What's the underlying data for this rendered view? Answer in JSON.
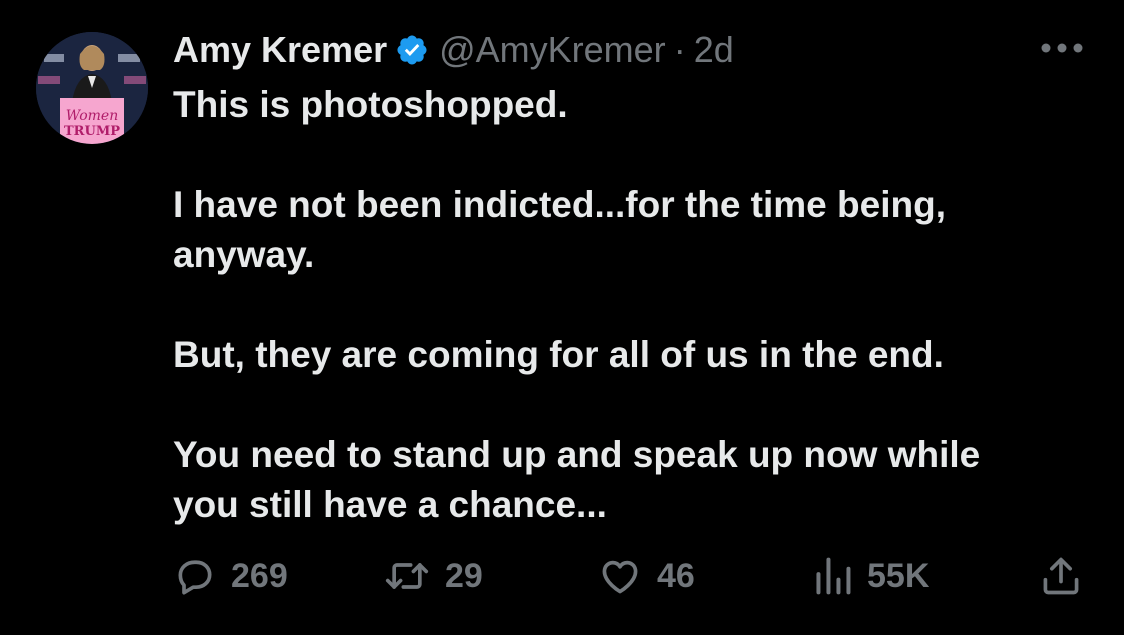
{
  "author": {
    "display_name": "Amy Kremer",
    "handle": "@AmyKremer",
    "separator": "·",
    "time": "2d",
    "verified": true,
    "avatar_sign_text": "Women",
    "avatar_sign_text2": "TRUMP"
  },
  "tweet": {
    "paragraphs": [
      "This is photoshopped.",
      "I have not been indicted...for the time being,\nanyway.",
      "But, they are coming for all of us in the end.",
      "You need to stand up and speak up now while\nyou still have a chance..."
    ]
  },
  "actions": {
    "replies": "269",
    "reposts": "29",
    "likes": "46",
    "views": "55K"
  },
  "colors": {
    "background": "#000000",
    "text": "#e7e9ea",
    "muted": "#71767b",
    "verified": "#1d9bf0"
  },
  "icons": [
    "verified-badge-icon",
    "more-icon",
    "reply-icon",
    "repost-icon",
    "like-icon",
    "views-icon",
    "share-icon"
  ]
}
